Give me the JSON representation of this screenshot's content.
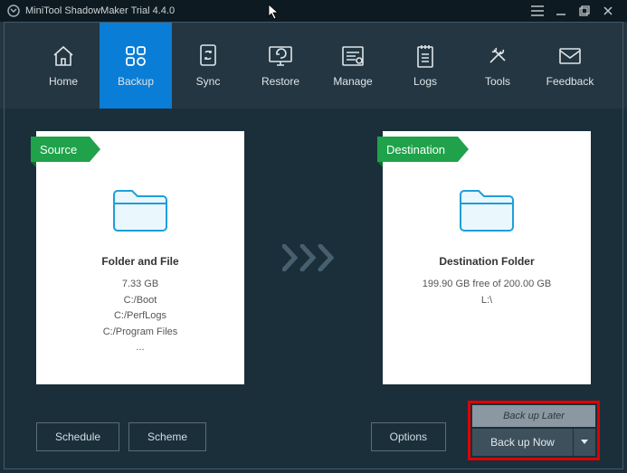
{
  "titlebar": {
    "title": "MiniTool ShadowMaker Trial 4.4.0"
  },
  "nav": {
    "items": [
      {
        "label": "Home"
      },
      {
        "label": "Backup"
      },
      {
        "label": "Sync"
      },
      {
        "label": "Restore"
      },
      {
        "label": "Manage"
      },
      {
        "label": "Logs"
      },
      {
        "label": "Tools"
      },
      {
        "label": "Feedback"
      }
    ]
  },
  "source": {
    "header": "Source",
    "title": "Folder and File",
    "size": "7.33 GB",
    "lines": [
      "C:/Boot",
      "C:/PerfLogs",
      "C:/Program Files",
      "..."
    ]
  },
  "destination": {
    "header": "Destination",
    "title": "Destination Folder",
    "free": "199.90 GB free of 200.00 GB",
    "drive": "L:\\"
  },
  "footer": {
    "schedule": "Schedule",
    "scheme": "Scheme",
    "options": "Options",
    "backup_later": "Back up Later",
    "backup_now": "Back up Now"
  }
}
